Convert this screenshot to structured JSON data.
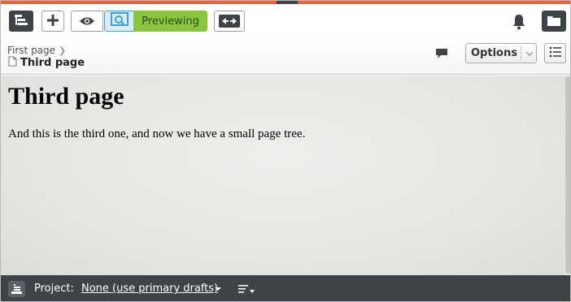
{
  "toolbar": {
    "previewing_label": "Previewing",
    "icons": [
      "page-tree-icon",
      "add-icon",
      "eye-icon",
      "preview-icon",
      "compare-icon",
      "bell-icon",
      "folder-icon"
    ]
  },
  "breadcrumb": {
    "parent": "First page",
    "current": "Third page",
    "options_label": "Options"
  },
  "content": {
    "heading": "Third page",
    "body": "And this is the third one, and now we have a small page tree."
  },
  "project_bar": {
    "label": "Project:",
    "value": "None (use primary drafts)"
  },
  "colors": {
    "accent_stripe": "#e8603c",
    "previewing_green": "#8bc540",
    "dark_bar": "#3d4347",
    "preview_blue": "#3ea0e2"
  }
}
